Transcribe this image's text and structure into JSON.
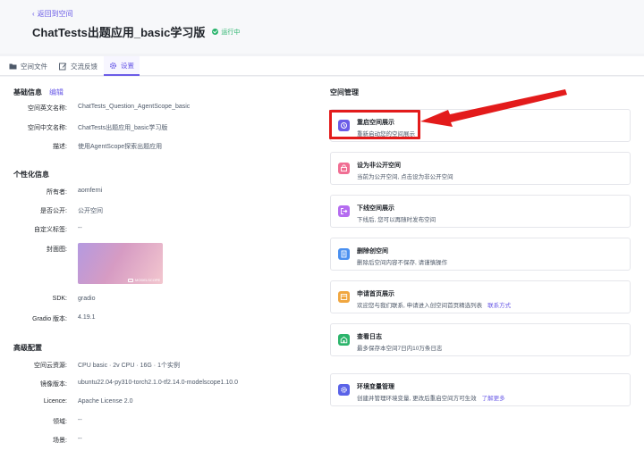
{
  "header": {
    "back_label": "返回到空间",
    "title": "ChatTests出题应用_basic学习版",
    "status": "运行中"
  },
  "tabs": [
    {
      "label": "空间文件",
      "icon": "folder-icon"
    },
    {
      "label": "交流反馈",
      "icon": "edit-icon"
    },
    {
      "label": "设置",
      "icon": "gear-icon",
      "active": true
    }
  ],
  "basic": {
    "title": "基础信息",
    "edit_label": "编辑",
    "rows": [
      {
        "label": "空间英文名称:",
        "value": "ChatTests_Question_AgentScope_basic"
      },
      {
        "label": "空间中文名称:",
        "value": "ChatTests出题应用_basic学习版"
      },
      {
        "label": "描述:",
        "value": "使用AgentScope探索出题应用"
      }
    ]
  },
  "personal": {
    "title": "个性化信息",
    "rows": [
      {
        "label": "所有者:",
        "value": "aomferni"
      },
      {
        "label": "是否公开:",
        "value": "公开空间"
      },
      {
        "label": "自定义标签:",
        "value": "--"
      },
      {
        "label": "封面图:",
        "value": ""
      },
      {
        "label": "SDK:",
        "value": "gradio"
      },
      {
        "label": "Gradio 版本:",
        "value": "4.19.1"
      }
    ],
    "cover_logo_text": "MODELSCOPE"
  },
  "advanced": {
    "title": "高级配置",
    "rows": [
      {
        "label": "空间云资源:",
        "value": "CPU basic · 2v CPU · 16G · 1个实例"
      },
      {
        "label": "镜像版本:",
        "value": "ubuntu22.04-py310-torch2.1.0-tf2.14.0-modelscope1.10.0"
      },
      {
        "label": "Licence:",
        "value": "Apache License 2.0"
      },
      {
        "label": "领域:",
        "value": "--"
      },
      {
        "label": "场景:",
        "value": "--"
      }
    ]
  },
  "management": {
    "title": "空间管理",
    "cards": [
      {
        "title": "重启空间展示",
        "desc": "重新启动您的空间展示",
        "icon": "restart-icon",
        "color": "#6b5ce7",
        "link": ""
      },
      {
        "title": "设为非公开空间",
        "desc": "当前为公开空间, 点击设为非公开空间",
        "icon": "lock-icon",
        "color": "#f06e93",
        "link": ""
      },
      {
        "title": "下线空间展示",
        "desc": "下线后, 您可以再随时发布空间",
        "icon": "logout-icon",
        "color": "#b56cf0",
        "link": ""
      },
      {
        "title": "删除创空间",
        "desc": "删除后空间内容不保存, 请谨慎操作",
        "icon": "document-icon",
        "color": "#4a90f0",
        "link": ""
      },
      {
        "title": "申请首页展示",
        "desc": "欢迎您与我们联系, 申请进入创空间首页精选列表",
        "icon": "homepage-icon",
        "color": "#f0a640",
        "link": "联系方式"
      },
      {
        "title": "查看日志",
        "desc": "最多保存本空间7日内10万条日志",
        "icon": "log-icon",
        "color": "#2cb46b",
        "link": ""
      },
      {
        "title": "环境变量管理",
        "desc": "创建并管理环境变量, 更改后重启空间方可生效",
        "icon": "settings-icon",
        "color": "#5a63e8",
        "link": "了解更多"
      }
    ]
  }
}
